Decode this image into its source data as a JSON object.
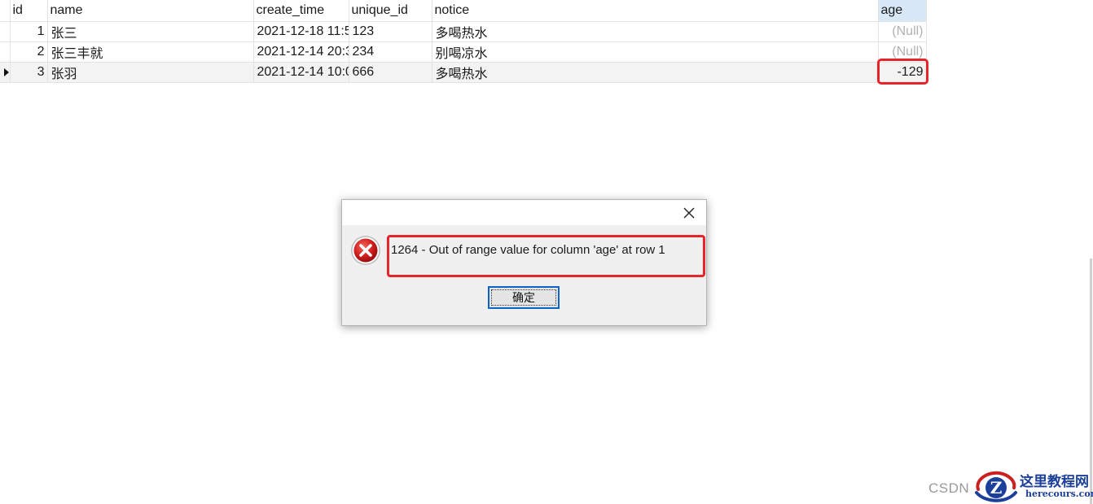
{
  "table": {
    "columns": [
      "id",
      "name",
      "create_time",
      "unique_id",
      "notice",
      "age"
    ],
    "rows": [
      {
        "id": "1",
        "name": "张三",
        "create_time": "2021-12-18 11:5",
        "unique_id": "123",
        "notice": "多喝热水",
        "age": "(Null)"
      },
      {
        "id": "2",
        "name": "张三丰就",
        "create_time": "2021-12-14 20:3",
        "unique_id": "234",
        "notice": "别喝凉水",
        "age": "(Null)"
      },
      {
        "id": "3",
        "name": "张羽",
        "create_time": "2021-12-14 10:0",
        "unique_id": "666",
        "notice": "多喝热水",
        "age": "-129"
      }
    ],
    "current_row": 3,
    "highlighted_cell": "age of row 3"
  },
  "dialog": {
    "message": "1264 - Out of range value for column 'age' at row 1",
    "ok_label": "确定",
    "icon": "error-icon",
    "close_icon": "close-icon"
  },
  "watermark": {
    "csdn": "CSDN",
    "brand_name": "这里教程网",
    "brand_url": "herecours.com"
  },
  "colors": {
    "highlight_red": "#e8242a",
    "age_header_bg": "#d8e8f6",
    "null_text": "#b2b2b2",
    "brand_blue": "#1c3f99",
    "button_focus": "#0a63c7"
  }
}
